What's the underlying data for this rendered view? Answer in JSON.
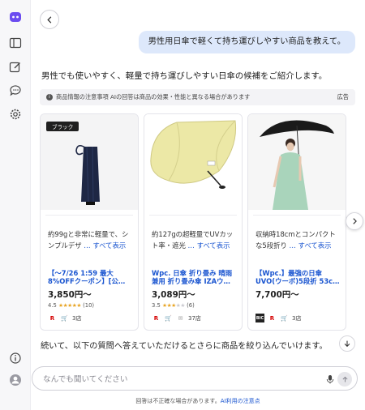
{
  "rail": {
    "items": [
      "copilot-logo-icon",
      "sidebar-toggle-icon",
      "new-chat-icon",
      "chat-bubble-icon",
      "settings-icon"
    ],
    "bottom": [
      "info-icon",
      "account-icon"
    ]
  },
  "conversation": {
    "user_message": "男性用日傘で軽くて持ち運びしやすい商品を教えて。",
    "answer_intro": "男性でも使いやすく、軽量で持ち運びしやすい日傘の候補をご紹介します。",
    "notice_text": "商品情報の注意事項  AIの回答は商品の効果・性能と異なる場合があります",
    "ad_label": "広告",
    "followup": "続いて、以下の質問へ答えていただけるとさらに商品を絞り込んでいけます。"
  },
  "products": [
    {
      "badge": "ブラック",
      "desc_line1": "約99gと非常に軽量で、シ",
      "desc_line2": "ンプルデザ",
      "more": "… すべて表示",
      "title_line1": "【〜7/26 1:59 最大",
      "title_line2": "8%OFFクーポン】[公…",
      "price": "3,850円〜",
      "rating_value": "4.5",
      "stars": "★★★★★",
      "review_count": "(10)",
      "shops": [
        "R",
        "🛒"
      ],
      "store_count": "3店"
    },
    {
      "badge": "",
      "desc_line1": "約127gの超軽量でUVカッ",
      "desc_line2": "ト率・遮光",
      "more": "… すべて表示",
      "title_line1": "Wpc. 日傘 折り畳み 晴雨",
      "title_line2": "兼用 折り畳み傘 IZAウ…",
      "price": "3,089円〜",
      "rating_value": "3.5",
      "stars": "★★★★★",
      "review_count": "(6)",
      "shops": [
        "R",
        "🛒",
        "✉"
      ],
      "store_count": "37店"
    },
    {
      "badge": "",
      "desc_line1": "収納時18cmとコンパクト",
      "desc_line2": "な5段折り",
      "more": "… すべて表示",
      "title_line1": "【Wpc.】最強の日傘",
      "title_line2": "UVO(ウーボ)5段折 53c…",
      "price": "7,700円〜",
      "rating_value": "",
      "stars": "",
      "review_count": "",
      "shops": [
        "BIC",
        "R",
        "🛒"
      ],
      "store_count": "3店"
    }
  ],
  "input": {
    "placeholder": "なんでも聞いてください"
  },
  "footer": {
    "text": "回答は不正確な場合があります。",
    "link": "AI利用の注意点"
  },
  "colors": {
    "accent_blue": "#1a55d0",
    "user_bubble": "#dde8fb",
    "star": "#e8a525",
    "rakuten_red": "#d40000"
  }
}
